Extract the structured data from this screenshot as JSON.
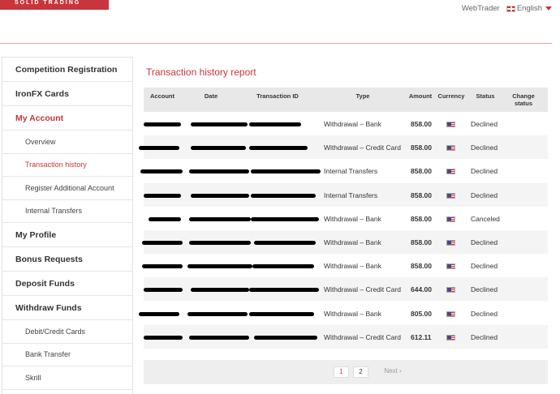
{
  "brand": {
    "logo_text": "SOLID TRADING"
  },
  "topnav": {
    "webtrader": "WebTrader",
    "language": "English",
    "flag_icon": "uk-flag-icon"
  },
  "sidebar": {
    "items": [
      {
        "label": "Competition Registration",
        "type": "main",
        "active": false
      },
      {
        "label": "IronFX Cards",
        "type": "main",
        "active": false
      },
      {
        "label": "My Account",
        "type": "main",
        "active": true
      },
      {
        "label": "Overview",
        "type": "sub",
        "active": false
      },
      {
        "label": "Transaction history",
        "type": "sub",
        "active": true
      },
      {
        "label": "Register Additional Account",
        "type": "sub",
        "active": false
      },
      {
        "label": "Internal Transfers",
        "type": "sub",
        "active": false
      },
      {
        "label": "My Profile",
        "type": "main",
        "active": false
      },
      {
        "label": "Bonus Requests",
        "type": "main",
        "active": false
      },
      {
        "label": "Deposit Funds",
        "type": "main",
        "active": false
      },
      {
        "label": "Withdraw Funds",
        "type": "main",
        "active": false
      },
      {
        "label": "Debit/Credit Cards",
        "type": "sub",
        "active": false
      },
      {
        "label": "Bank Transfer",
        "type": "sub",
        "active": false
      },
      {
        "label": "Skrill",
        "type": "sub",
        "active": false
      }
    ]
  },
  "report": {
    "title": "Transaction history report",
    "columns": {
      "account": "Account",
      "date": "Date",
      "transaction_id": "Transaction ID",
      "type": "Type",
      "amount": "Amount",
      "currency": "Currency",
      "status": "Status",
      "change_status": "Change status"
    },
    "rows": [
      {
        "type": "Withdrawal – Bank",
        "amount": "858.00",
        "currency_icon": "us-flag-icon",
        "status": "Declined"
      },
      {
        "type": "Withdrawal – Credit Card",
        "amount": "858.00",
        "currency_icon": "us-flag-icon",
        "status": "Declined"
      },
      {
        "type": "Internal Transfers",
        "amount": "858.00",
        "currency_icon": "us-flag-icon",
        "status": "Declined"
      },
      {
        "type": "Internal Transfers",
        "amount": "858.00",
        "currency_icon": "us-flag-icon",
        "status": "Declined"
      },
      {
        "type": "Withdrawal – Bank",
        "amount": "858.00",
        "currency_icon": "us-flag-icon",
        "status": "Canceled"
      },
      {
        "type": "Withdrawal – Bank",
        "amount": "858.00",
        "currency_icon": "us-flag-icon",
        "status": "Declined"
      },
      {
        "type": "Withdrawal – Bank",
        "amount": "858.00",
        "currency_icon": "us-flag-icon",
        "status": "Declined"
      },
      {
        "type": "Withdrawal – Credit Card",
        "amount": "644.00",
        "currency_icon": "us-flag-icon",
        "status": "Declined"
      },
      {
        "type": "Withdrawal – Bank",
        "amount": "805.00",
        "currency_icon": "us-flag-icon",
        "status": "Declined"
      },
      {
        "type": "Withdrawal – Credit Card",
        "amount": "612.11",
        "currency_icon": "us-flag-icon",
        "status": "Declined"
      }
    ],
    "pagination": {
      "pages": [
        "1",
        "2"
      ],
      "current": "1",
      "next_label": "Next ›"
    }
  }
}
